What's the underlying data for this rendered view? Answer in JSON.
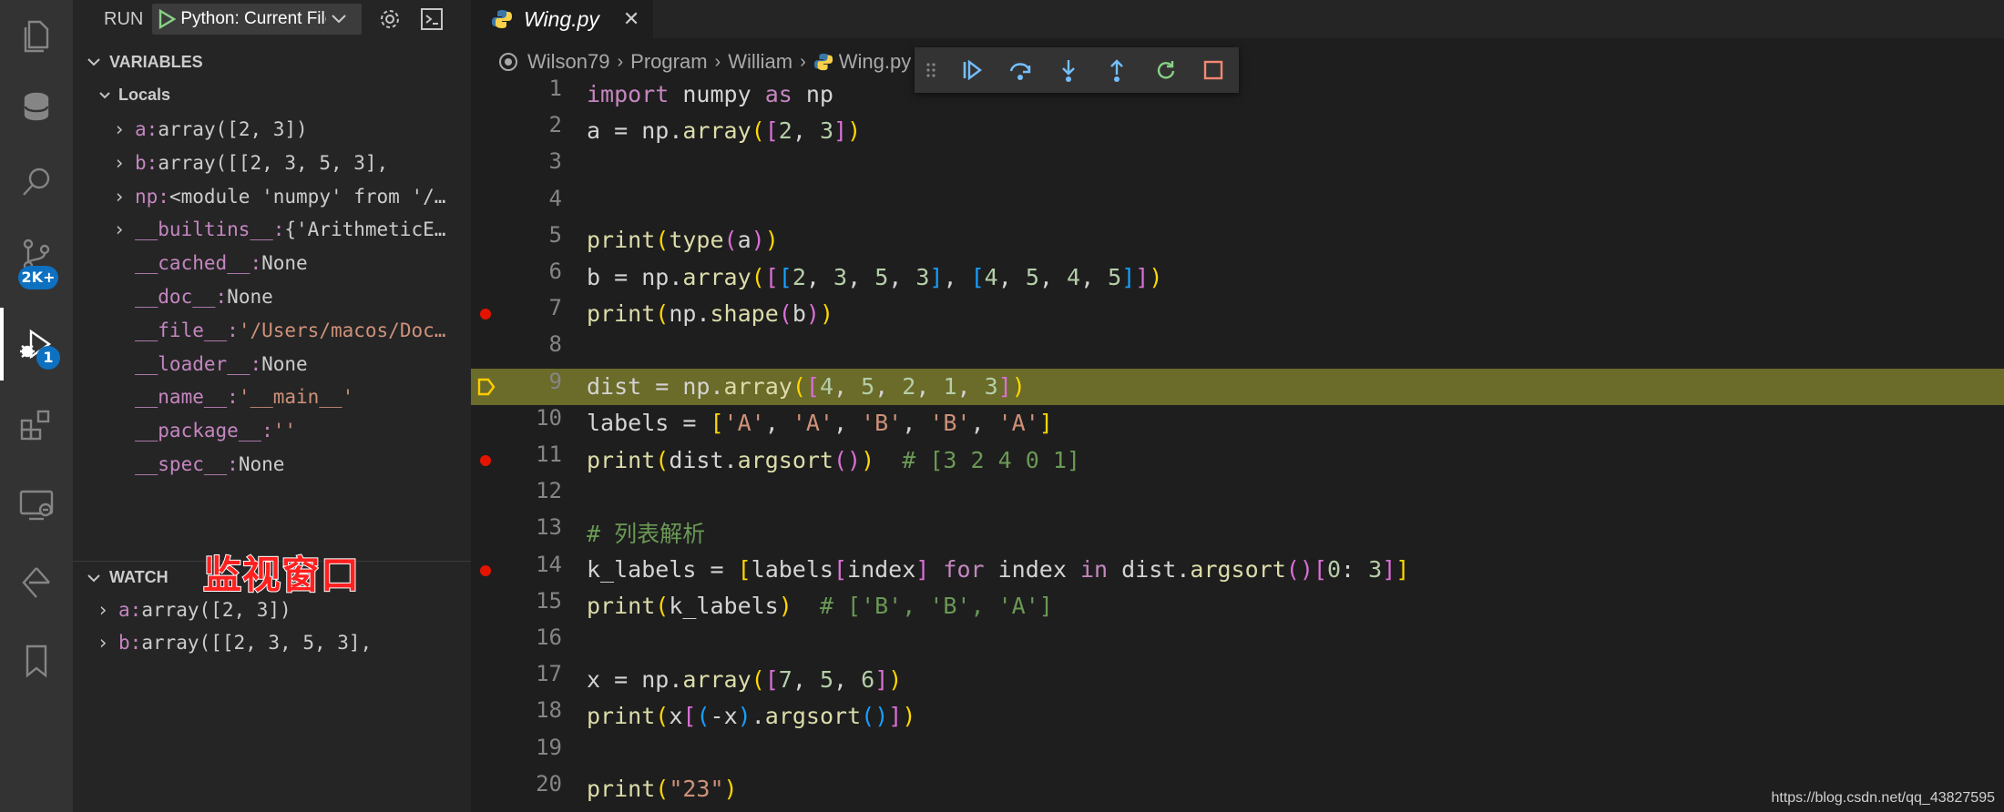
{
  "activity_bar": {
    "icons": [
      "files-icon",
      "database-icon",
      "search-icon",
      "source-control-icon",
      "run-debug-icon",
      "extensions-icon",
      "remote-explorer-icon",
      "testing-icon",
      "bookmarks-icon"
    ],
    "source_control_badge": "2K+",
    "debug_badge": "1"
  },
  "run_panel": {
    "run_label": "RUN",
    "config_name": "Python: Current File",
    "variables_header": "VARIABLES",
    "locals_label": "Locals",
    "variables": [
      {
        "name": "a",
        "value": "array([2, 3])",
        "expandable": true
      },
      {
        "name": "b",
        "value": "array([[2, 3, 5, 3],",
        "expandable": true
      },
      {
        "name": "np",
        "value": "<module 'numpy' from '/…",
        "expandable": true
      },
      {
        "name": "__builtins__",
        "value": "{'ArithmeticE…",
        "expandable": true
      },
      {
        "name": "__cached__",
        "value": "None",
        "expandable": false
      },
      {
        "name": "__doc__",
        "value": "None",
        "expandable": false
      },
      {
        "name": "__file__",
        "value": "'/Users/macos/Doc…",
        "expandable": false
      },
      {
        "name": "__loader__",
        "value": "None",
        "expandable": false
      },
      {
        "name": "__name__",
        "value": "'__main__'",
        "expandable": false
      },
      {
        "name": "__package__",
        "value": "''",
        "expandable": false
      },
      {
        "name": "__spec__",
        "value": "None",
        "expandable": false
      }
    ],
    "watch_header": "WATCH",
    "watch_annotation": "监视窗口",
    "watch_items": [
      {
        "name": "a",
        "value": "array([2, 3])"
      },
      {
        "name": "b",
        "value": "array([[2, 3, 5, 3],"
      }
    ]
  },
  "editor": {
    "tab_label": "Wing.py",
    "breadcrumb": [
      "Wilson79",
      "Program",
      "William",
      "Wing.py"
    ],
    "current_line": 9,
    "breakpoints": [
      7,
      11,
      14
    ],
    "lines": [
      {
        "n": "1",
        "text": "import numpy as np"
      },
      {
        "n": "2",
        "text": "a = np.array([2, 3])"
      },
      {
        "n": "3",
        "text": ""
      },
      {
        "n": "4",
        "text": ""
      },
      {
        "n": "5",
        "text": "print(type(a))"
      },
      {
        "n": "6",
        "text": "b = np.array([[2, 3, 5, 3], [4, 5, 4, 5]])"
      },
      {
        "n": "7",
        "text": "print(np.shape(b))"
      },
      {
        "n": "8",
        "text": ""
      },
      {
        "n": "9",
        "text": "dist = np.array([4, 5, 2, 1, 3])"
      },
      {
        "n": "10",
        "text": "labels = ['A', 'A', 'B', 'B', 'A']"
      },
      {
        "n": "11",
        "text": "print(dist.argsort())  # [3 2 4 0 1]"
      },
      {
        "n": "12",
        "text": ""
      },
      {
        "n": "13",
        "text": "# 列表解析"
      },
      {
        "n": "14",
        "text": "k_labels = [labels[index] for index in dist.argsort()[0: 3]]"
      },
      {
        "n": "15",
        "text": "print(k_labels)  # ['B', 'B', 'A']"
      },
      {
        "n": "16",
        "text": ""
      },
      {
        "n": "17",
        "text": "x = np.array([7, 5, 6])"
      },
      {
        "n": "18",
        "text": "print(x[(-x).argsort()])"
      },
      {
        "n": "19",
        "text": ""
      },
      {
        "n": "20",
        "text": "print(\"23\")"
      }
    ]
  },
  "debug_toolbar": [
    "drag-handle-icon",
    "continue-icon",
    "step-over-icon",
    "step-into-icon",
    "step-out-icon",
    "restart-icon",
    "stop-icon"
  ],
  "watermark": "https://blog.csdn.net/qq_43827595"
}
